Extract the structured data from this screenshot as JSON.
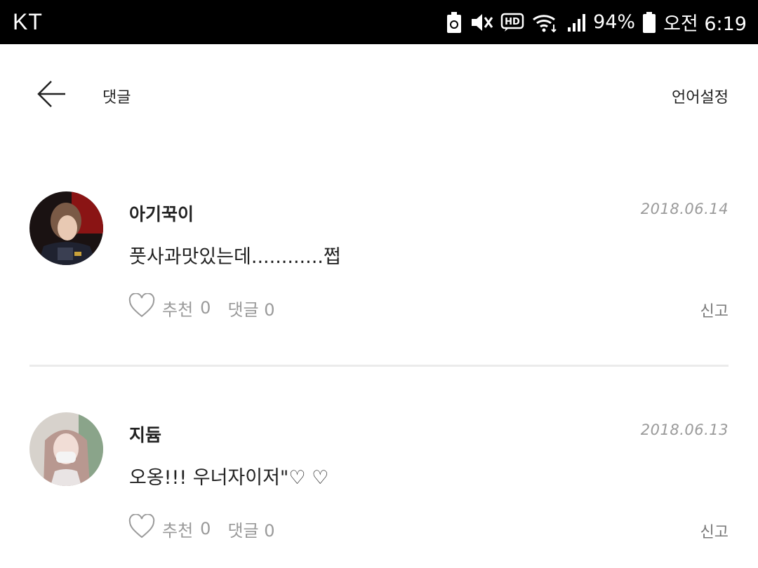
{
  "status_bar": {
    "carrier": "KT",
    "battery_percent": "94%",
    "time": "오전 6:19",
    "icons": [
      "recycle-battery-icon",
      "mute-icon",
      "hd-icon",
      "wifi-icon",
      "signal-icon",
      "battery-icon"
    ]
  },
  "header": {
    "title": "댓글",
    "language_button": "언어설정",
    "back_icon": "arrow-left-icon"
  },
  "comments": [
    {
      "author": "아기꾹이",
      "date": "2018.06.14",
      "text": "풋사과맛있는데............쩝",
      "like_label": "추천",
      "like_count": "0",
      "reply_label": "댓글",
      "reply_count": "0",
      "report_label": "신고"
    },
    {
      "author": "지듐",
      "date": "2018.06.13",
      "text": "오옹!!! 우너자이저\"♡ ♡",
      "like_label": "추천",
      "like_count": "0",
      "reply_label": "댓글",
      "reply_count": "0",
      "report_label": "신고"
    }
  ],
  "colors": {
    "status_bar_bg": "#000000",
    "background": "#ffffff",
    "muted_text": "#9a9a9a",
    "divider": "#ebebeb"
  }
}
